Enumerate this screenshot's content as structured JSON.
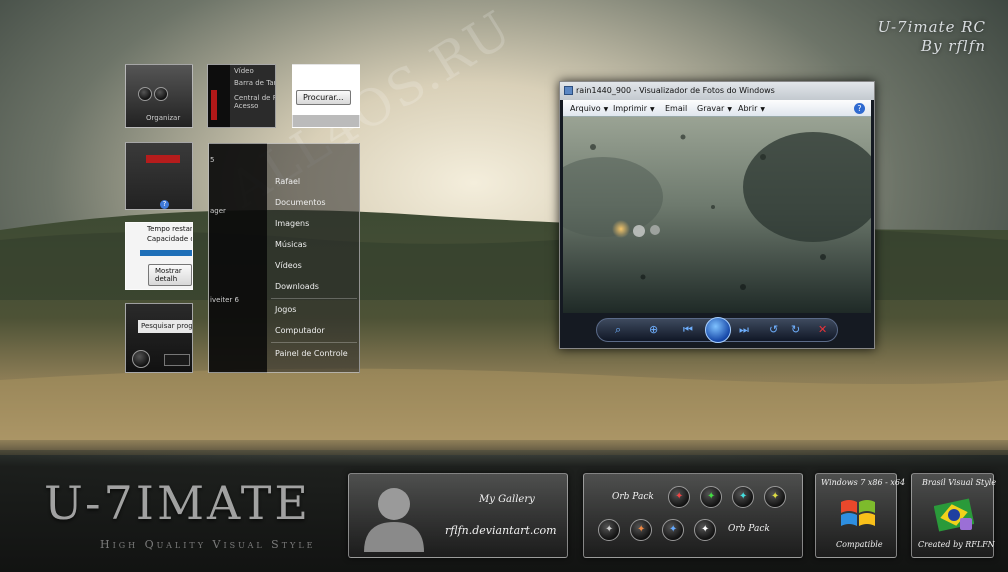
{
  "branding": {
    "title": "U-7imate RC",
    "byline": "By rflfn",
    "watermark": "ALL4OS.RU",
    "logo": "U-7IMATE",
    "logo_subtitle": "High Quality Visual Style"
  },
  "preview_tiles": {
    "organizar": "Organizar",
    "video": "Vídeo",
    "taskbar": "Barra de Tar",
    "central": "Central de Fa",
    "acesso": "Acesso",
    "procurar": "Procurar...",
    "tempo": "Tempo restante",
    "capacidade": "Capacidade de",
    "mostrar": "Mostrar detalh",
    "pesquisar": "Pesquisar progr",
    "ager": "ager",
    "iveiter": "iveiter 6",
    "s5": "5"
  },
  "start_menu": {
    "items": [
      "Rafael",
      "Documentos",
      "Imagens",
      "Músicas",
      "Vídeos",
      "Downloads",
      "Jogos",
      "Computador",
      "Painel de Controle"
    ]
  },
  "viewer": {
    "title": "rain1440_900 - Visualizador de Fotos do Windows",
    "menu": [
      {
        "label": "Arquivo"
      },
      {
        "label": "Imprimir"
      },
      {
        "label": "Email"
      },
      {
        "label": "Gravar"
      },
      {
        "label": "Abrir"
      }
    ],
    "help": "?",
    "controls": [
      "zoom-icon",
      "fit-window-icon",
      "previous-icon",
      "slideshow-icon",
      "next-icon",
      "rotate-left-icon",
      "rotate-right-icon",
      "delete-icon"
    ]
  },
  "panels": {
    "gallery_label": "My Gallery",
    "deviantart": "rflfn.deviantart.com",
    "orb_pack_1": "Orb Pack",
    "orb_pack_2": "Orb Pack",
    "win7_title": "Windows 7 x86 - x64",
    "compatible": "Compatible",
    "brasil_title": "Brasil Visual Style",
    "created_by": "Created by RFLFN"
  },
  "colors": {
    "accent": "#6fb0ff",
    "delete": "#e8333a"
  }
}
